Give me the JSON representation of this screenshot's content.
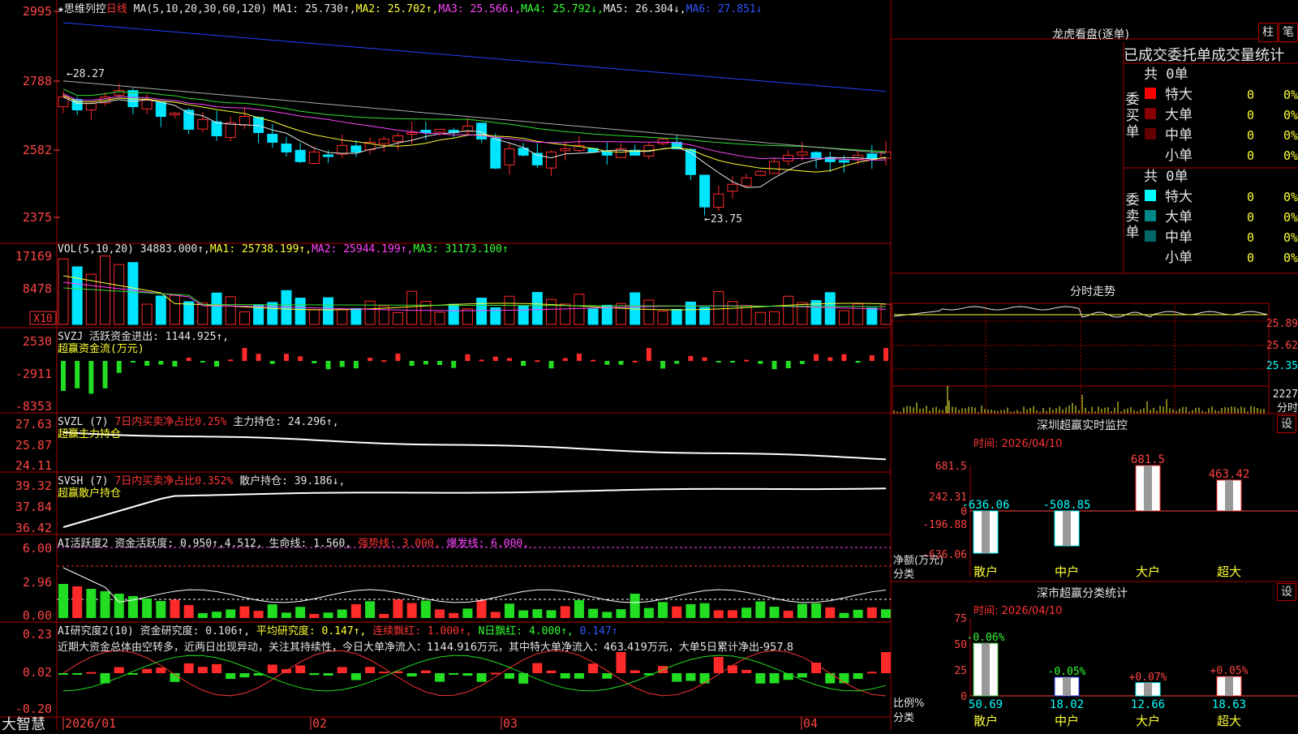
{
  "colors": {
    "up": "#ff2a2a",
    "down": "#00e5ff",
    "ma1": "#e6e6e6",
    "ma2": "#ffff33",
    "ma3": "#ff44ff",
    "ma4": "#33dd33",
    "ma5": "#aaaaaa",
    "ma6": "#2244ff",
    "grid": "#aa0000"
  },
  "header": {
    "title": "★思维列控",
    "period": "日线",
    "ma_label": "MA(5,10,20,30,60,120)",
    "ma1": "MA1: 25.730↑,",
    "ma2": "MA2: 25.702↑,",
    "ma3": "MA3: 25.566↓,",
    "ma4": "MA4: 25.792↓,",
    "ma5": "MA5: 26.304↓,",
    "ma6": "MA6: 27.851↓"
  },
  "price_panel": {
    "y_ticks": [
      "2995",
      "2788",
      "2582",
      "2375"
    ],
    "high_label": "←28.27",
    "low_label": "←23.75"
  },
  "vol_panel": {
    "label": "VOL(5,10,20)",
    "val": "34883.000↑,",
    "ma1": "MA1: 25738.199↑,",
    "ma2": "MA2: 25944.199↑,",
    "ma3": "MA3: 31173.100↑",
    "y_ticks": [
      "17169",
      "8478"
    ],
    "unit": "X10"
  },
  "svzj_panel": {
    "label": "SVZJ",
    "text1": "活跃资金进出: 1144.925↑,",
    "text2": "超赢资金流(万元)",
    "y_ticks": [
      "2530",
      "-2911",
      "-8353"
    ]
  },
  "svzl_panel": {
    "label": "SVZL (7)",
    "text1": "7日内买卖净占比0.25%",
    "text2": "主力持仓: 24.296↑,",
    "text3": "超赢主力持仓",
    "y_ticks": [
      "27.63",
      "25.87",
      "24.11"
    ]
  },
  "svsh_panel": {
    "label": "SVSH (7)",
    "text1": "7日内买卖净占比0.352%",
    "text2": "散户持仓: 39.186↓,",
    "text3": "超赢散户持仓",
    "y_ticks": [
      "39.32",
      "37.84",
      "36.42"
    ]
  },
  "ai1_panel": {
    "label": "AI活跃度2",
    "text1": "资金活跃度: 0.950↑,4.512,",
    "text2": "生命线: 1.560,",
    "text3": "强势线: 3.000,",
    "text4": "爆发线: 6.000,",
    "y_ticks": [
      "6.00",
      "2.96",
      "0.00"
    ]
  },
  "ai2_panel": {
    "label": "AI研究度2(10)",
    "text1": "资金研究度: 0.106↑,",
    "text2": "平均研究度: 0.147↑,",
    "text3": "连续飘红: 1.000↑,",
    "text4": "N日飘红: 4.000↑,",
    "text5": "0.147↑",
    "comment": "近期大资金总体由空转多，近两日出现异动，关注其持续性，今日大单净流入：1144.916万元，其中特大单净流入：463.419万元，大单5日累计净出-957.8",
    "y_ticks": [
      "0.23",
      "0.02",
      "-0.20"
    ]
  },
  "x_axis": {
    "labels": [
      "2026/01",
      "02",
      "03",
      "04"
    ]
  },
  "brand": "大智慧",
  "dragon": {
    "title": "龙虎看盘(逐单)",
    "btn_bar": "柱",
    "btn_pen": "笔",
    "header": "已成交委托单成交量统计",
    "buy_label": "委买单",
    "sell_label": "委卖单",
    "buy_total": "共 0单",
    "sell_total": "共 0单",
    "rows": [
      "特大",
      "大单",
      "中单",
      "小单"
    ],
    "zero": "0",
    "pct": "0%",
    "buy_colors": [
      "#ff0000",
      "#880000",
      "#660000",
      "#000000"
    ],
    "sell_colors": [
      "#00ffff",
      "#008888",
      "#006666",
      "#000000"
    ]
  },
  "intraday": {
    "title": "分时走势",
    "y_ticks": [
      "25.89",
      "25.62",
      "25.35"
    ],
    "vol_tick": "2227",
    "vol_unit": "分时"
  },
  "monitor": {
    "title": "深圳超赢实时监控",
    "setting": "设",
    "date": "时间: 2026/04/10",
    "y_ticks": [
      "681.5",
      "242.31",
      "0",
      "-196.88",
      "-636.06"
    ],
    "y_caption": "净额(万元)",
    "x_caption": "分类",
    "categories": [
      "散户",
      "中户",
      "大户",
      "超大"
    ],
    "values": [
      -636.06,
      -508.85,
      681.5,
      463.42
    ],
    "value_labels": [
      "-636.06",
      "-508.85",
      "681.5",
      "463.42"
    ]
  },
  "classify": {
    "title": "深市超赢分类统计",
    "setting": "设",
    "date": "时间: 2026/04/10",
    "y_ticks": [
      "75",
      "50",
      "25",
      "0"
    ],
    "y_caption": "比例%",
    "x_caption": "分类",
    "categories": [
      "散户",
      "中户",
      "大户",
      "超大"
    ],
    "values": [
      50.69,
      18.02,
      12.66,
      18.63
    ],
    "value_labels": [
      "50.69",
      "18.02",
      "12.66",
      "18.63"
    ],
    "delta_labels": [
      "-0.06%",
      "-0.05%",
      "+0.07%",
      "+0.05%"
    ]
  },
  "chart_data": [
    {
      "type": "line",
      "title": "思维列控 日线",
      "ylim": [
        23.75,
        29.95
      ],
      "note": "candlestick daily price",
      "high": 28.27,
      "low": 23.75
    },
    {
      "type": "bar",
      "title": "深圳超赢实时监控",
      "categories": [
        "散户",
        "中户",
        "大户",
        "超大"
      ],
      "values": [
        -636.06,
        -508.85,
        681.5,
        463.42
      ],
      "ylabel": "净额(万元)"
    },
    {
      "type": "bar",
      "title": "深市超赢分类统计",
      "categories": [
        "散户",
        "中户",
        "大户",
        "超大"
      ],
      "values": [
        50.69,
        18.02,
        12.66,
        18.63
      ],
      "ylabel": "比例%",
      "ylim": [
        0,
        75
      ]
    }
  ]
}
